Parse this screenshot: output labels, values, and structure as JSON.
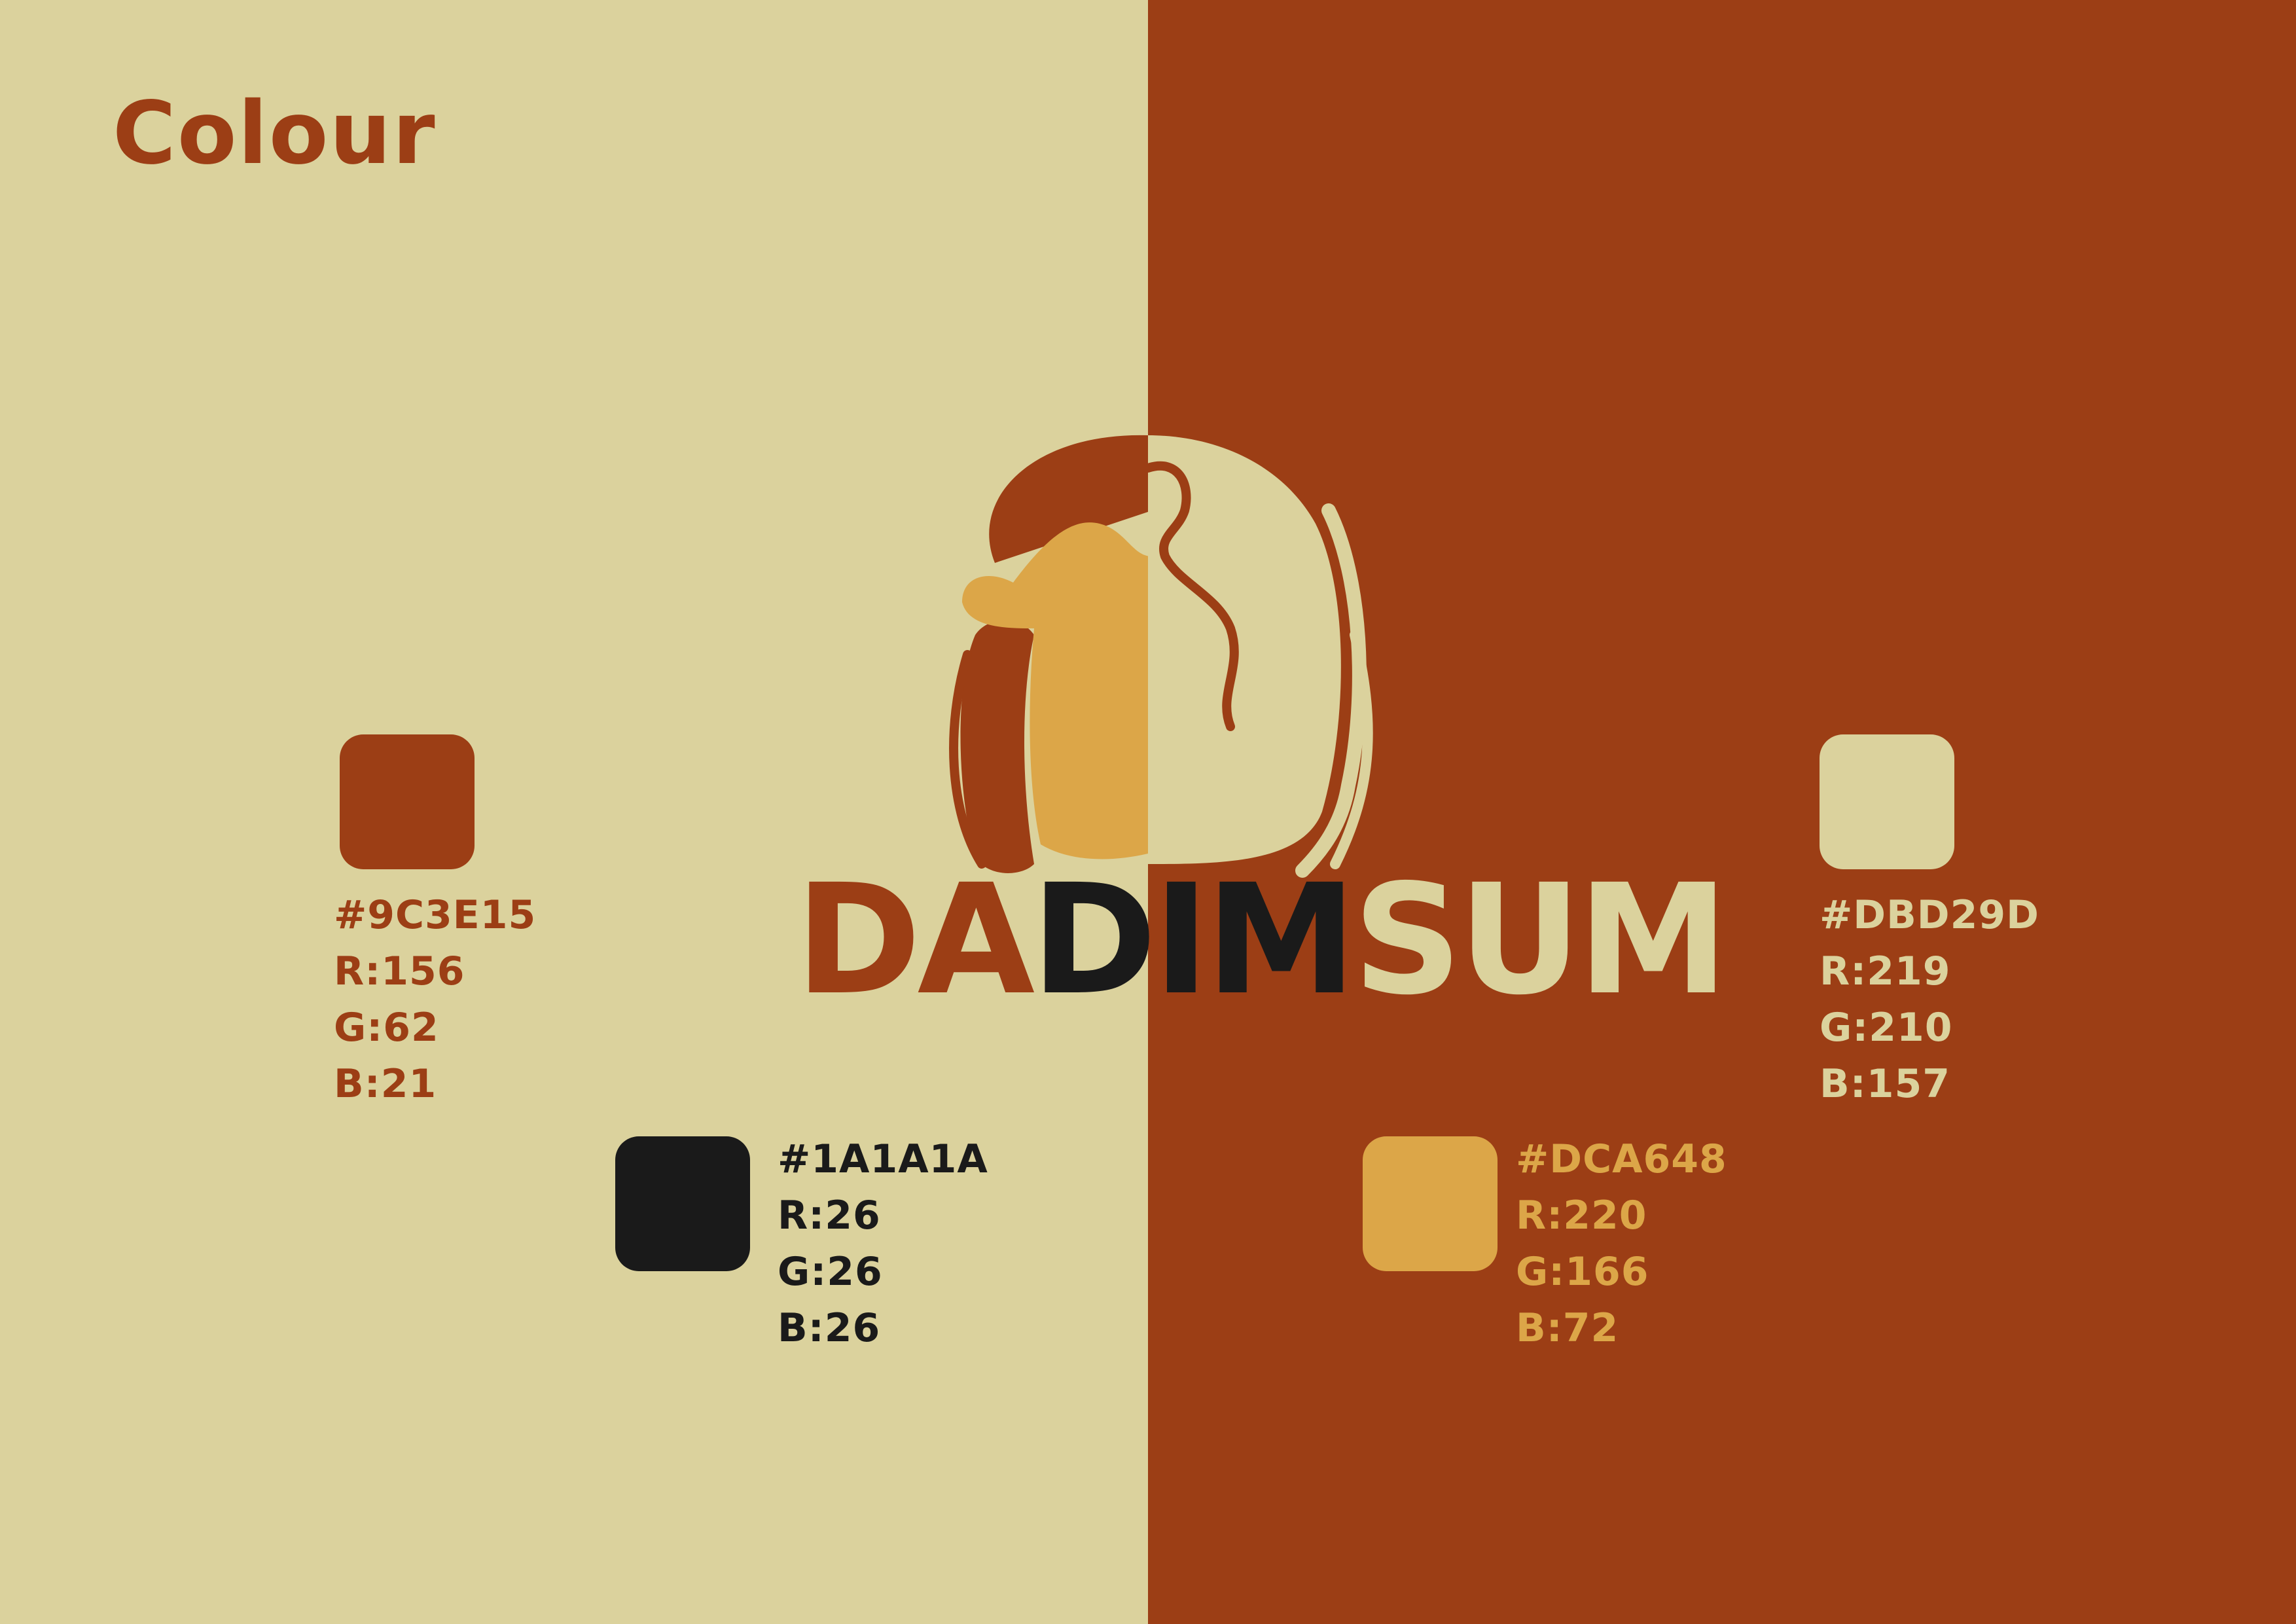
{
  "title": "Colour",
  "logo": {
    "name": "DADIMSUM",
    "parts": [
      "DA",
      "DI",
      "M",
      "SUM"
    ],
    "part_colors": [
      "#9C3E15",
      "#1A1A1A",
      "#1A1A1A",
      "#DBD29D"
    ]
  },
  "swatches": [
    {
      "hex": "#9C3E15",
      "r": "R:156",
      "g": "G:62",
      "b": "B:21",
      "color": "#9C3E15",
      "text_color": "#9C3E15"
    },
    {
      "hex": "#1A1A1A",
      "r": "R:26",
      "g": "G:26",
      "b": "B:26",
      "color": "#1A1A1A",
      "text_color": "#1A1A1A"
    },
    {
      "hex": "#DCA648",
      "r": "R:220",
      "g": "G:166",
      "b": "B:72",
      "color": "#DCA648",
      "text_color": "#DCA648"
    },
    {
      "hex": "#DBD29D",
      "r": "R:219",
      "g": "G:210",
      "b": "B:157",
      "color": "#DBD29D",
      "text_color": "#DBD29D"
    }
  ]
}
